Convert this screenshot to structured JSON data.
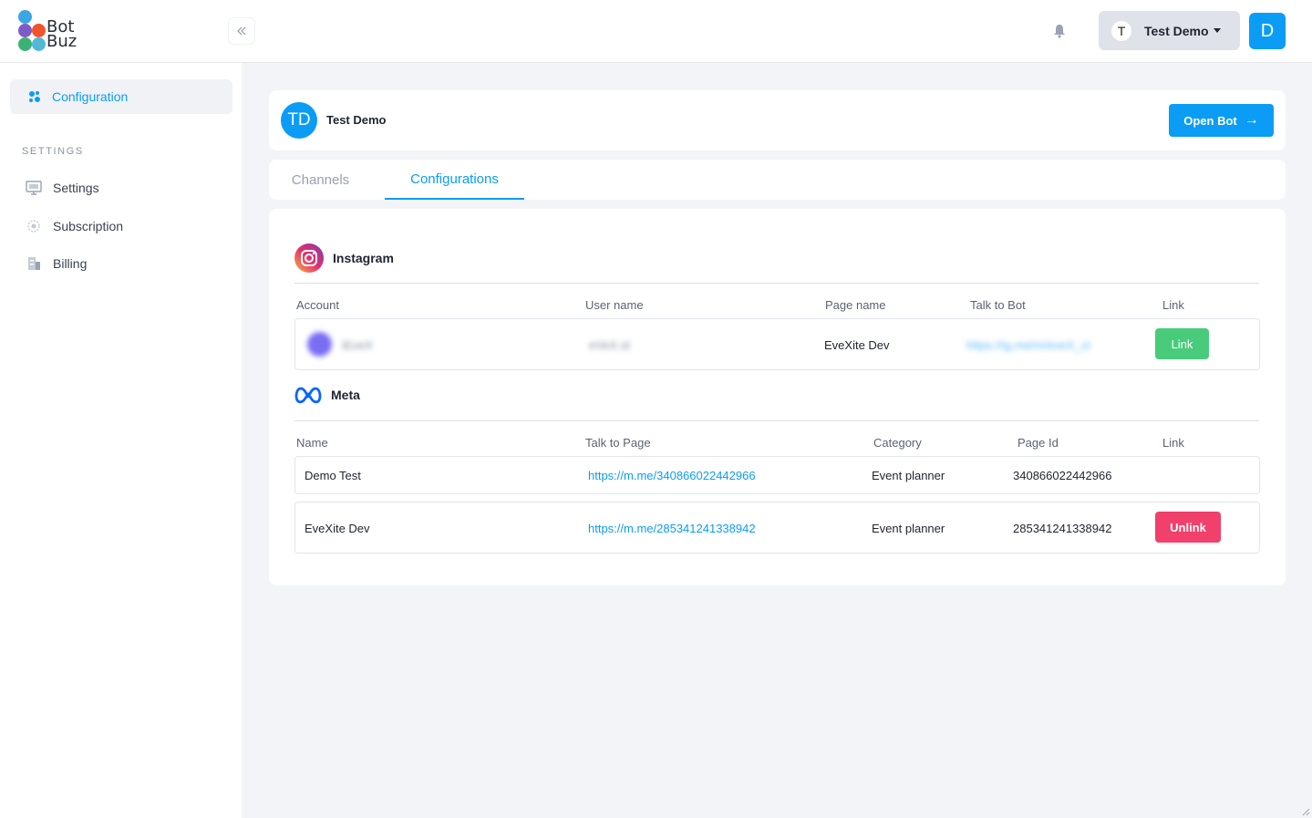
{
  "brand": {
    "logo_line1": "Bot",
    "logo_line2": "Buz"
  },
  "header": {
    "user_initial": "T",
    "user_name": "Test Demo",
    "avatar_letter": "D"
  },
  "sidebar": {
    "active_item": {
      "label": "Configuration",
      "icon": "configuration-icon"
    },
    "section_title": "SETTINGS",
    "items": [
      {
        "label": "Settings",
        "icon": "monitor-icon"
      },
      {
        "label": "Subscription",
        "icon": "subscription-icon"
      },
      {
        "label": "Billing",
        "icon": "billing-icon"
      }
    ]
  },
  "bot": {
    "initials": "TD",
    "name": "Test Demo",
    "open_label": "Open Bot",
    "open_arrow": "→"
  },
  "tabs": [
    {
      "label": "Channels",
      "active": false
    },
    {
      "label": "Configurations",
      "active": true
    }
  ],
  "instagram": {
    "title": "Instagram",
    "columns": [
      "Account",
      "User name",
      "Page name",
      "Talk to Bot",
      "Link"
    ],
    "row": {
      "account": "iEveX",
      "user_name": "eVeX.st",
      "page_name": "EveXite Dev",
      "talk_to_bot": "https://ig.me/m/eveX_ct",
      "button": "Link"
    }
  },
  "meta": {
    "title": "Meta",
    "columns": [
      "Name",
      "Talk to Page",
      "Category",
      "Page Id",
      "Link"
    ],
    "rows": [
      {
        "name": "Demo Test",
        "talk_to_page": "https://m.me/340866022442966",
        "category": "Event planner",
        "page_id": "340866022442966",
        "button": ""
      },
      {
        "name": "EveXite Dev",
        "talk_to_page": "https://m.me/285341241338942",
        "category": "Event planner",
        "page_id": "285341241338942",
        "button": "Unlink"
      }
    ]
  },
  "colors": {
    "accent": "#0b9cf5",
    "link_green": "#48cc7c",
    "unlink_red": "#f0406b"
  }
}
